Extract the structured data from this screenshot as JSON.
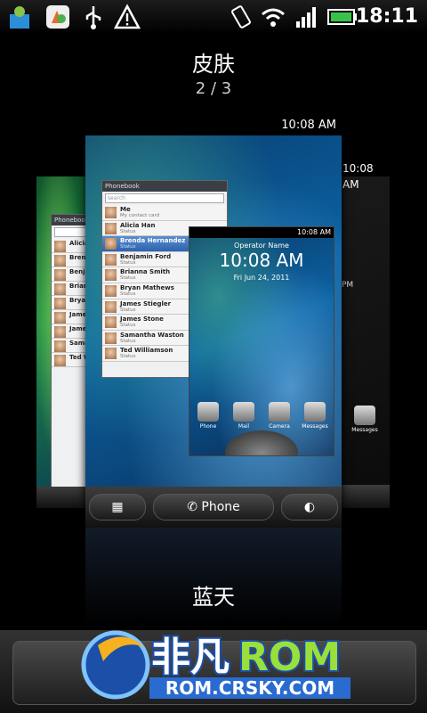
{
  "status_bar": {
    "time": "18:11",
    "icons": [
      "android-market-icon",
      "app-icon",
      "usb-icon",
      "warning-icon",
      "vibrate-icon",
      "wifi-icon",
      "signal-icon",
      "battery-icon"
    ]
  },
  "header": {
    "title": "皮肤",
    "pager": "2 / 3"
  },
  "skins": {
    "center": {
      "mini_time": "10:08 AM",
      "dock": {
        "phone_label": "Phone"
      },
      "phonebook": {
        "title": "Phonebook",
        "search_placeholder": "search",
        "contacts": [
          {
            "name": "Me",
            "status": "My contact card"
          },
          {
            "name": "Alicia Han",
            "status": "Status"
          },
          {
            "name": "Brenda Hernandez",
            "status": "Status",
            "selected": true
          },
          {
            "name": "Benjamin Ford",
            "status": "Status"
          },
          {
            "name": "Brianna Smith",
            "status": "Status"
          },
          {
            "name": "Bryan Mathews",
            "status": "Status"
          },
          {
            "name": "James Stiegler",
            "status": "Status"
          },
          {
            "name": "James Stone",
            "status": "Status"
          },
          {
            "name": "Samantha Waston",
            "status": "Status"
          },
          {
            "name": "Ted Williamson",
            "status": "Status"
          }
        ]
      },
      "lockscreen": {
        "mini_time": "10:08 AM",
        "operator": "Operator Name",
        "time": "10:08 AM",
        "date": "Fri Jun 24, 2011",
        "apps": [
          "Phone",
          "Mail",
          "Camera",
          "Messages"
        ]
      }
    },
    "left": {
      "phonebook_title": "Phonebook",
      "names": [
        "Alicia",
        "Brenda",
        "Benjam",
        "Brianna",
        "Bryan M",
        "James S",
        "James S",
        "Samant",
        "Ted Wil"
      ]
    },
    "right": {
      "mini_time": "10:08 AM",
      "pm": "PM",
      "app": "Messages"
    }
  },
  "skin_name": "蓝天",
  "watermark": {
    "brand_cn": "非凡",
    "brand_en": "ROM",
    "url": "ROM.CRSKY.COM"
  }
}
